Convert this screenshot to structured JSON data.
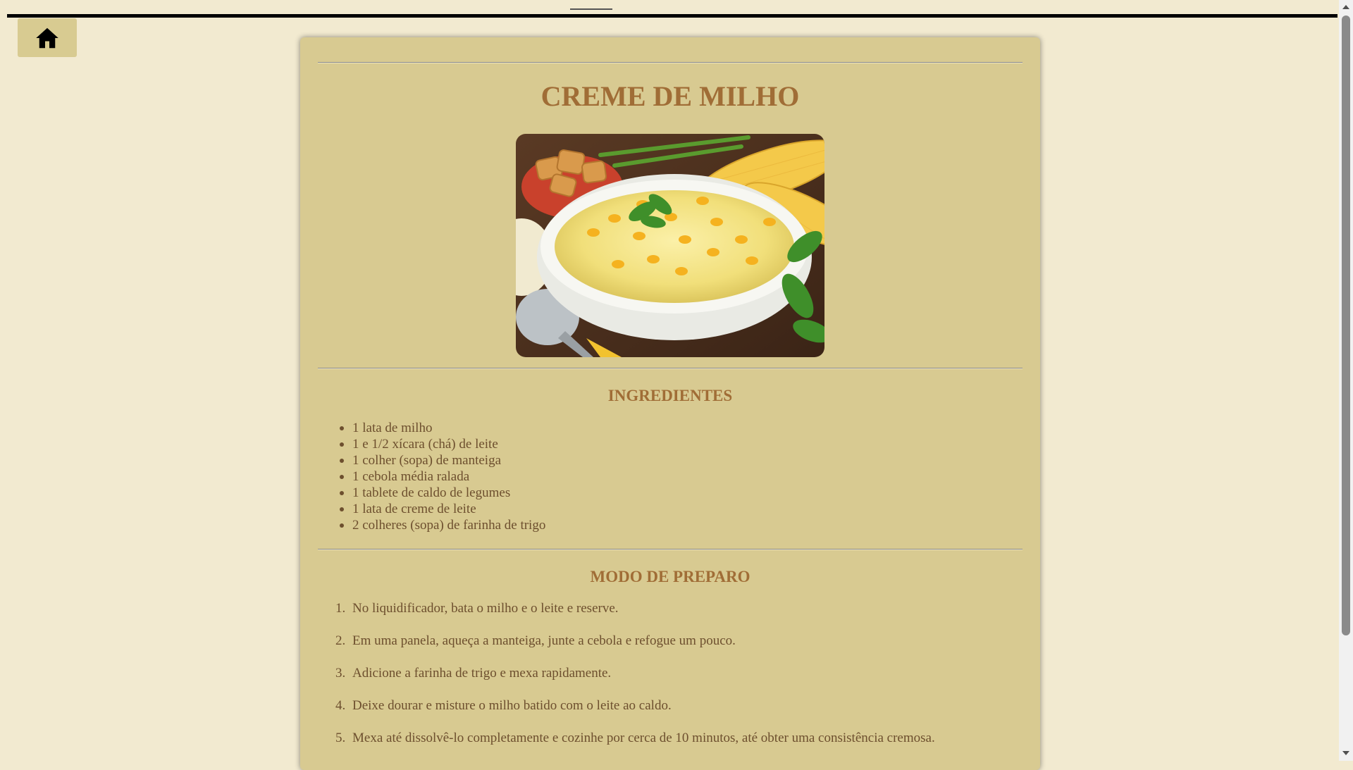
{
  "nav": {
    "home_icon": "home-icon"
  },
  "recipe": {
    "title": "CREME DE MILHO",
    "image_icon": "corn-soup-photo",
    "ingredients_title": "INGREDIENTES",
    "ingredients": [
      "1 lata de milho",
      "1 e 1/2 xícara (chá) de leite",
      "1 colher (sopa) de manteiga",
      "1 cebola média ralada",
      "1 tablete de caldo de legumes",
      "1 lata de creme de leite",
      "2 colheres (sopa) de farinha de trigo"
    ],
    "steps_title": "MODO DE PREPARO",
    "steps": [
      {
        "num": "1.",
        "text": "No liquidificador, bata o milho e o leite e reserve."
      },
      {
        "num": "2.",
        "text": "Em uma panela, aqueça a manteiga, junte a cebola e refogue um pouco."
      },
      {
        "num": "3.",
        "text": "Adicione a farinha de trigo e mexa rapidamente."
      },
      {
        "num": "4.",
        "text": "Deixe dourar e misture o milho batido com o leite ao caldo."
      },
      {
        "num": "5.",
        "text": "Mexa até dissolvê-lo completamente e cozinhe por cerca de 10 minutos, até obter uma consistência cremosa."
      }
    ]
  },
  "colors": {
    "page_bg": "#f2ead0",
    "card_bg": "#d8ca91",
    "heading": "#a06d36",
    "body_text": "#6d4f2e"
  }
}
